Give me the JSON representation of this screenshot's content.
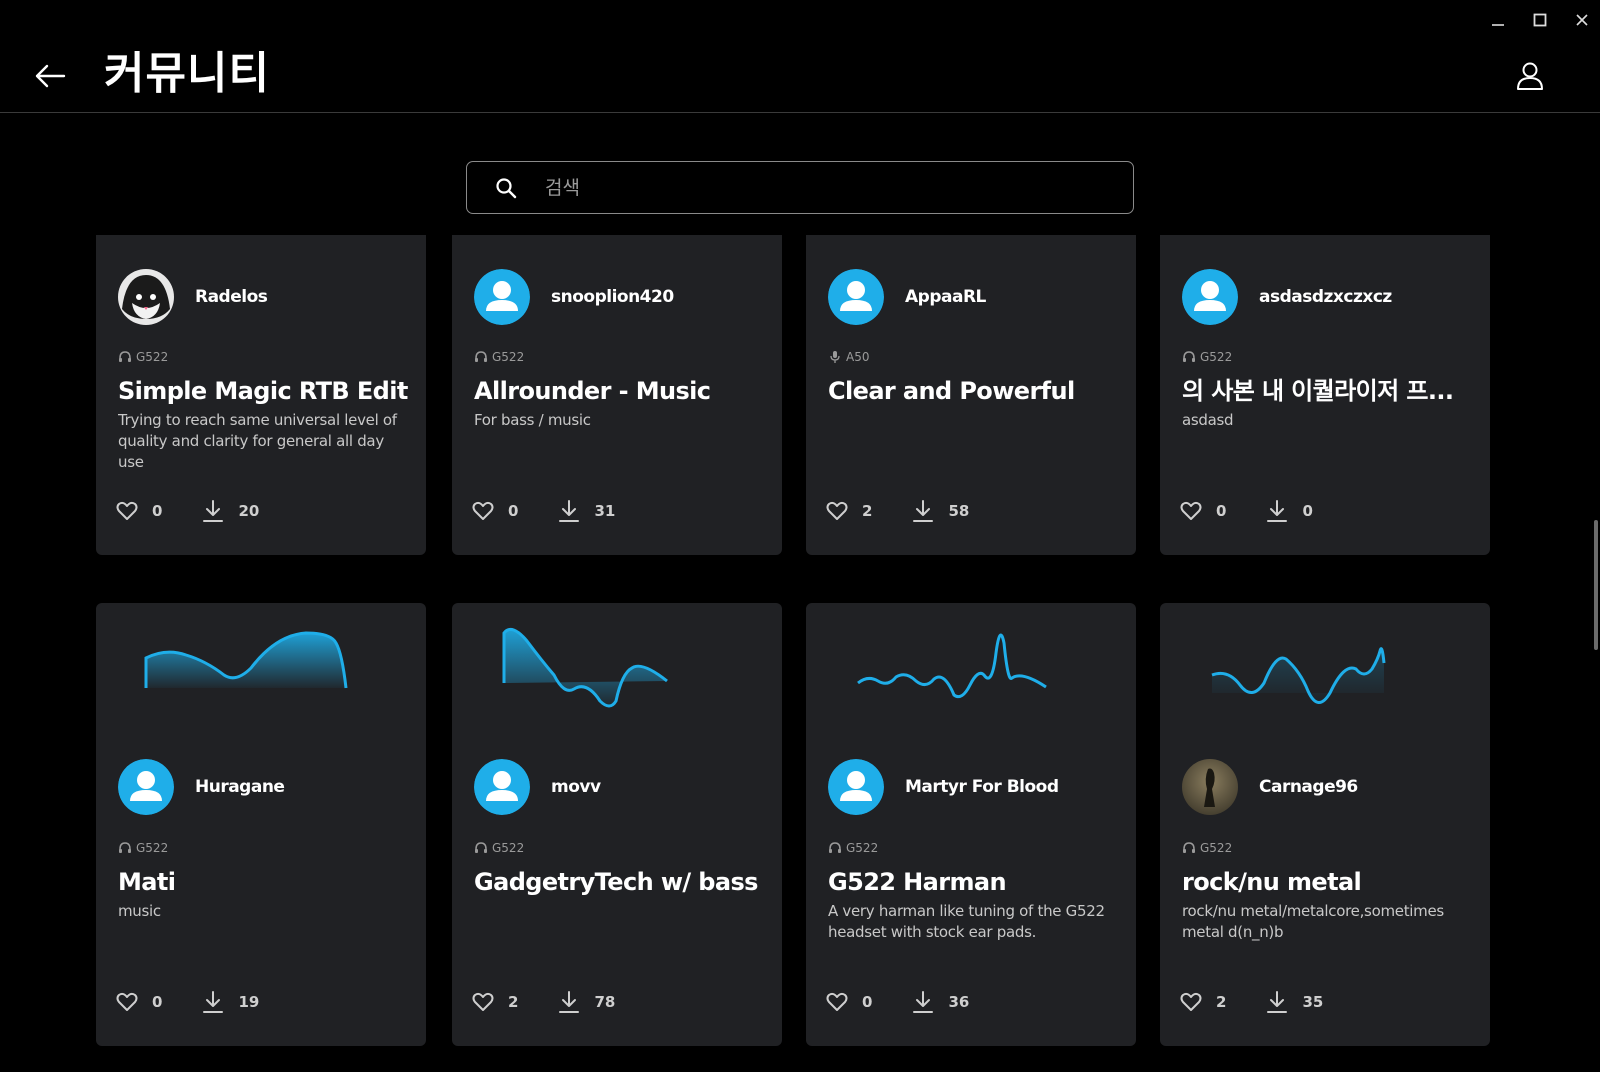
{
  "app": {
    "title": "커뮤니티",
    "window_controls": {
      "minimize": "–",
      "maximize": "☐",
      "close": "✕"
    },
    "icons": {
      "back": "arrow-left-icon",
      "profile": "user-icon"
    }
  },
  "search": {
    "placeholder": "검색",
    "value": ""
  },
  "colors": {
    "accent": "#1faee9",
    "card": "#202124",
    "background": "#000000"
  },
  "presets": [
    {
      "author": "Radelos",
      "avatar": "custom-photo",
      "device": "G522",
      "device_icon": "headset-icon",
      "title": "Simple Magic RTB Edit",
      "description": "Trying to reach same universal level of quality and clarity for general all day use",
      "likes": "0",
      "downloads": "20"
    },
    {
      "author": "snooplion420",
      "avatar": "default",
      "device": "G522",
      "device_icon": "headset-icon",
      "title": "Allrounder - Music",
      "description": "For bass / music",
      "likes": "0",
      "downloads": "31"
    },
    {
      "author": "AppaaRL",
      "avatar": "default",
      "device": "A50",
      "device_icon": "microphone-icon",
      "title": "Clear and Powerful",
      "description": "",
      "likes": "2",
      "downloads": "58"
    },
    {
      "author": "asdasdzxczxcz",
      "avatar": "default",
      "device": "G522",
      "device_icon": "headset-icon",
      "title": "의 사본 내 이퀄라이저 프...",
      "description": "asdasd",
      "likes": "0",
      "downloads": "0"
    },
    {
      "author": "Huragane",
      "avatar": "default",
      "device": "G522",
      "device_icon": "headset-icon",
      "title": "Mati",
      "description": "music",
      "likes": "0",
      "downloads": "19"
    },
    {
      "author": "movv",
      "avatar": "default",
      "device": "G522",
      "device_icon": "headset-icon",
      "title": "GadgetryTech w/ bass",
      "description": "",
      "likes": "2",
      "downloads": "78"
    },
    {
      "author": "Martyr For Blood",
      "avatar": "default",
      "device": "G522",
      "device_icon": "headset-icon",
      "title": "G522 Harman",
      "description": "A very harman like tuning of the G522 headset with stock ear pads.",
      "likes": "0",
      "downloads": "36"
    },
    {
      "author": "Carnage96",
      "avatar": "custom-photo",
      "device": "G522",
      "device_icon": "headset-icon",
      "title": "rock/nu metal",
      "description": "rock/nu metal/metalcore,sometimes metal d(n_n)b",
      "likes": "2",
      "downloads": "35"
    }
  ]
}
